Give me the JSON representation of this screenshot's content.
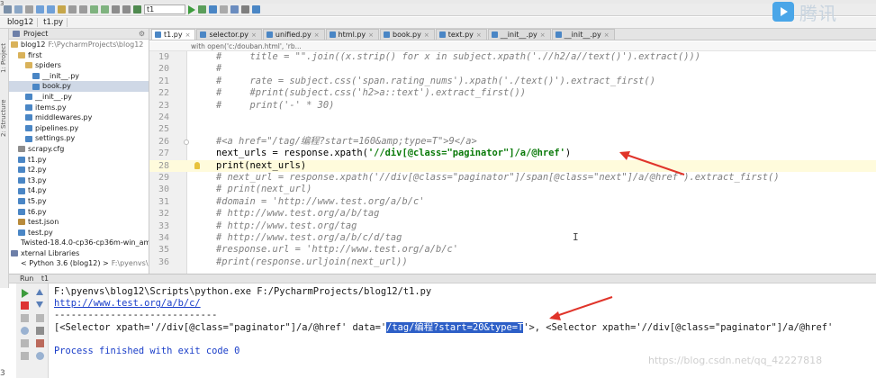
{
  "toolbar": {
    "run_config": "t1"
  },
  "navbar": {
    "crumbs": [
      "blog12",
      "t1.py"
    ]
  },
  "sidebar": {
    "tabs": [
      "1: Project",
      "2: Structure"
    ],
    "header": "Project",
    "items": [
      {
        "label": "blog12",
        "suffix": "F:\\PycharmProjects\\blog12",
        "indent": 0,
        "icon": "folder-icon"
      },
      {
        "label": "first",
        "indent": 1,
        "icon": "folder-icon"
      },
      {
        "label": "spiders",
        "indent": 2,
        "icon": "folder-icon"
      },
      {
        "label": "__init__.py",
        "indent": 3,
        "icon": "python-file-icon"
      },
      {
        "label": "book.py",
        "indent": 3,
        "icon": "python-file-icon",
        "selected": true
      },
      {
        "label": "__init__.py",
        "indent": 2,
        "icon": "python-file-icon"
      },
      {
        "label": "items.py",
        "indent": 2,
        "icon": "python-file-icon"
      },
      {
        "label": "middlewares.py",
        "indent": 2,
        "icon": "python-file-icon"
      },
      {
        "label": "pipelines.py",
        "indent": 2,
        "icon": "python-file-icon"
      },
      {
        "label": "settings.py",
        "indent": 2,
        "icon": "python-file-icon"
      },
      {
        "label": "scrapy.cfg",
        "indent": 1,
        "icon": "config-file-icon"
      },
      {
        "label": "t1.py",
        "indent": 1,
        "icon": "python-file-icon"
      },
      {
        "label": "t2.py",
        "indent": 1,
        "icon": "python-file-icon"
      },
      {
        "label": "t3.py",
        "indent": 1,
        "icon": "python-file-icon"
      },
      {
        "label": "t4.py",
        "indent": 1,
        "icon": "python-file-icon"
      },
      {
        "label": "t5.py",
        "indent": 1,
        "icon": "python-file-icon"
      },
      {
        "label": "t6.py",
        "indent": 1,
        "icon": "python-file-icon"
      },
      {
        "label": "test.json",
        "indent": 1,
        "icon": "json-file-icon"
      },
      {
        "label": "test.py",
        "indent": 1,
        "icon": "python-file-icon"
      },
      {
        "label": "Twisted-18.4.0-cp36-cp36m-win_amd64.whl",
        "indent": 1,
        "icon": "archive-file-icon"
      },
      {
        "label": "xternal Libraries",
        "indent": 0,
        "icon": "library-icon"
      },
      {
        "label": "< Python 3.6 (blog12) >",
        "suffix": "F:\\pyenvs\\blog12",
        "indent": 1,
        "icon": "library-icon"
      }
    ]
  },
  "editor": {
    "tabs": [
      {
        "label": "t1.py",
        "active": true,
        "icon": "python-file-icon"
      },
      {
        "label": "selector.py",
        "icon": "python-file-icon"
      },
      {
        "label": "unified.py",
        "icon": "python-file-icon"
      },
      {
        "label": "html.py",
        "icon": "python-file-icon"
      },
      {
        "label": "book.py",
        "icon": "python-file-icon"
      },
      {
        "label": "text.py",
        "icon": "python-file-icon"
      },
      {
        "label": "__init__.py",
        "icon": "python-file-icon"
      },
      {
        "label": "__init__.py",
        "icon": "python-file-icon"
      }
    ],
    "breadcrumb": "with open('c:/douban.html', 'rb...",
    "lines": [
      {
        "n": "19",
        "text": "#     title = \"\".join((x.strip() for x in subject.xpath('.//h2/a//text()').extract()))",
        "kind": "comment"
      },
      {
        "n": "20",
        "text": "#",
        "kind": "comment"
      },
      {
        "n": "21",
        "text": "#     rate = subject.css('span.rating_nums').xpath('./text()').extract_first()",
        "kind": "comment"
      },
      {
        "n": "22",
        "text": "#     #print(subject.css('h2>a::text').extract_first())",
        "kind": "comment"
      },
      {
        "n": "23",
        "text": "#     print('-' * 30)",
        "kind": "comment"
      },
      {
        "n": "24",
        "text": "",
        "kind": "plain"
      },
      {
        "n": "25",
        "text": "",
        "kind": "plain"
      },
      {
        "n": "26",
        "text": "#<a href=\"/tag/编程?start=160&amp;type=T\">9</a>",
        "kind": "comment"
      },
      {
        "n": "27",
        "pre": "next_urls = response.xpath(",
        "str": "'//div[@class=\"paginator\"]/a/@href'",
        "post": ")",
        "kind": "mixed"
      },
      {
        "n": "28",
        "text": "print(next_urls)",
        "kind": "plain",
        "current": true
      },
      {
        "n": "29",
        "text": "# next_url = response.xpath('//div[@class=\"paginator\"]/span[@class=\"next\"]/a/@href').extract_first()",
        "kind": "comment"
      },
      {
        "n": "30",
        "text": "# print(next_url)",
        "kind": "comment"
      },
      {
        "n": "31",
        "text": "#domain = 'http://www.test.org/a/b/c'",
        "kind": "comment"
      },
      {
        "n": "32",
        "text": "# http://www.test.org/a/b/tag",
        "kind": "comment"
      },
      {
        "n": "33",
        "text": "# http://www.test.org/tag",
        "kind": "comment"
      },
      {
        "n": "34",
        "text": "# http://www.test.org/a/b/c/d/tag",
        "kind": "comment"
      },
      {
        "n": "35",
        "text": "#response.url = 'http://www.test.org/a/b/c'",
        "kind": "comment"
      },
      {
        "n": "36",
        "text": "#print(response.urljoin(next_url))",
        "kind": "comment"
      }
    ]
  },
  "run": {
    "header": "Run",
    "config": "t1",
    "lines": [
      {
        "text": "F:\\pyenvs\\blog12\\Scripts\\python.exe F:/PycharmProjects/blog12/t1.py"
      },
      {
        "text": "http://www.test.org/a/b/c/",
        "link": true
      },
      {
        "text": "-----------------------------"
      },
      {
        "pre": "[<Selector xpath='//div[@class=\"paginator\"]/a/@href' data='",
        "sel": "/tag/编程?start=20&type=T",
        "post": "'>, <Selector xpath='//div[@class=\"paginator\"]/a/@href'"
      },
      {
        "text": ""
      },
      {
        "text": "Process finished with exit code 0",
        "process": true
      }
    ]
  },
  "overlay": {
    "logo_text": "腾讯",
    "watermark": "https://blog.csdn.net/qq_42227818",
    "corner_top": "3",
    "corner_bottom": "3"
  }
}
